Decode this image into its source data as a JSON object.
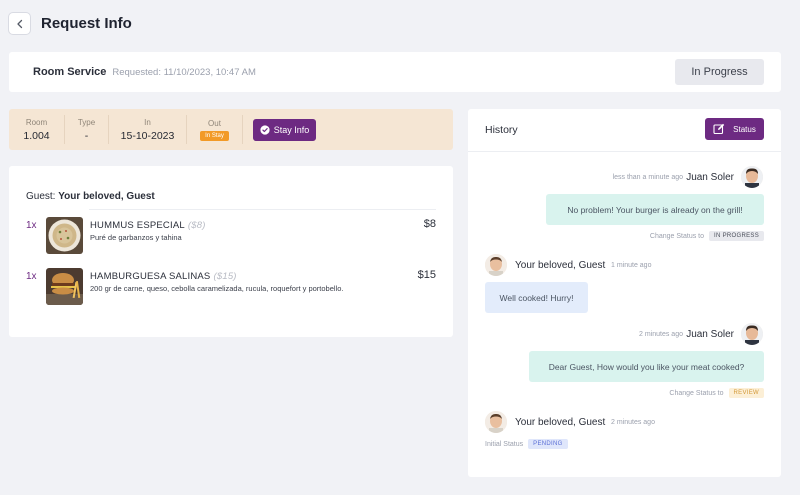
{
  "header": {
    "title": "Request Info"
  },
  "service": {
    "name": "Room Service",
    "requested": "Requested: 11/10/2023, 10:47 AM",
    "status_button": "In Progress"
  },
  "stay": {
    "room_label": "Room",
    "room_value": "1.004",
    "type_label": "Type",
    "type_value": "-",
    "in_label": "In",
    "in_value": "15-10-2023",
    "out_label": "Out",
    "out_badge": "In Stay",
    "stay_info_button": "Stay Info"
  },
  "order": {
    "guest_prefix": "Guest:",
    "guest_name": "Your beloved, Guest",
    "items": [
      {
        "qty": "1x",
        "name": "HUMMUS ESPECIAL",
        "orig_price": "($8)",
        "desc": "Puré de garbanzos y tahina",
        "price": "$8"
      },
      {
        "qty": "1x",
        "name": "HAMBURGUESA SALINAS",
        "orig_price": "($15)",
        "desc": "200 gr de carne, queso, cebolla caramelizada, rucula, roquefort y portobello.",
        "price": "$15"
      }
    ]
  },
  "history": {
    "title": "History",
    "status_button": "Status",
    "messages": [
      {
        "time": "less than a minute ago",
        "author": "Juan Soler",
        "text": "No problem! Your burger is already on the grill!",
        "note_label": "Change Status to",
        "note_pill": "IN PROGRESS"
      },
      {
        "time": "1 minute ago",
        "author": "Your beloved, Guest",
        "text": "Well cooked! Hurry!"
      },
      {
        "time": "2 minutes ago",
        "author": "Juan Soler",
        "text": "Dear Guest, How would you like your meat cooked?",
        "note_label": "Change Status to",
        "note_pill": "REVIEW"
      },
      {
        "time": "2 minutes ago",
        "author": "Your beloved, Guest",
        "note_label": "Initial Status",
        "note_pill": "PENDING"
      }
    ]
  },
  "colors": {
    "accent": "#6d2a82",
    "stay_bg": "#f5e6d4",
    "out_badge": "#f29a27",
    "bubble_staff": "#d9f3ee",
    "bubble_guest": "#e3ecfb"
  },
  "icons": {
    "back": "chevron-left-icon",
    "stay_info": "check-circle-icon",
    "status": "edit-icon"
  }
}
